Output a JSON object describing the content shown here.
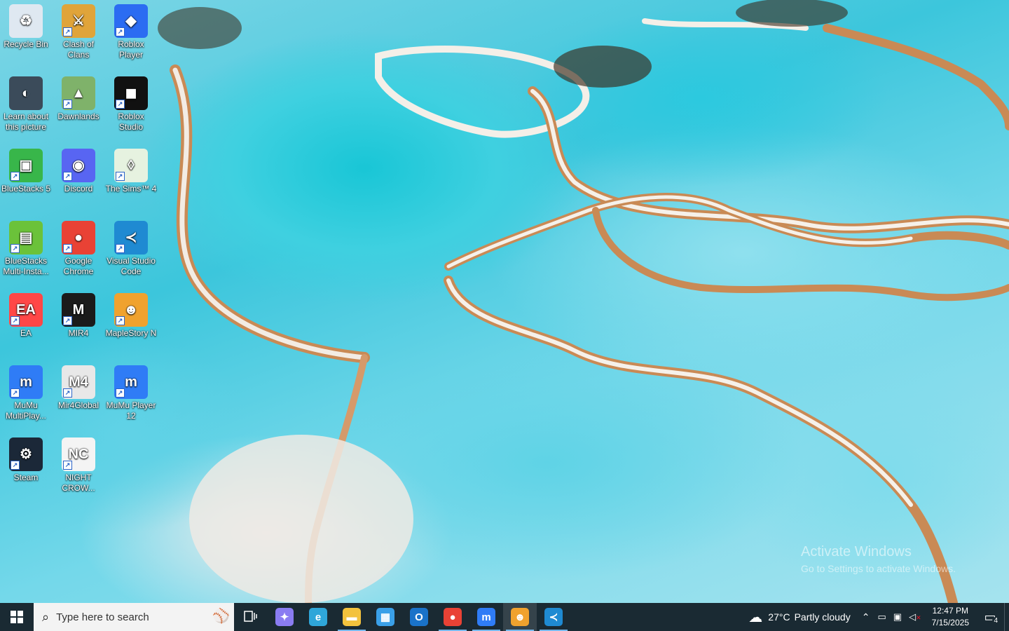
{
  "desktop_icons": [
    {
      "label": "Recycle Bin",
      "icon": "recycle-bin-icon",
      "color": "#dfe8f1",
      "glyph": "♻",
      "shortcut": false
    },
    {
      "label": "Clash of Clans",
      "icon": "clash-of-clans-icon",
      "color": "#e0a43a",
      "glyph": "⚔",
      "shortcut": true
    },
    {
      "label": "Roblox Player",
      "icon": "roblox-player-icon",
      "color": "#2b6cf2",
      "glyph": "◆",
      "shortcut": true
    },
    {
      "label": "Learn about this picture",
      "icon": "learn-about-picture-icon",
      "color": "#3b4b5a",
      "glyph": "◐",
      "shortcut": false
    },
    {
      "label": "Dawnlands",
      "icon": "dawnlands-icon",
      "color": "#7fb26a",
      "glyph": "▲",
      "shortcut": true
    },
    {
      "label": "Roblox Studio",
      "icon": "roblox-studio-icon",
      "color": "#111111",
      "glyph": "◼",
      "shortcut": true
    },
    {
      "label": "BlueStacks 5",
      "icon": "bluestacks5-icon",
      "color": "#38b64a",
      "glyph": "▣",
      "shortcut": true
    },
    {
      "label": "Discord",
      "icon": "discord-icon",
      "color": "#5865f2",
      "glyph": "◉",
      "shortcut": true
    },
    {
      "label": "The Sims™ 4",
      "icon": "sims4-icon",
      "color": "#e6f2e0",
      "glyph": "◊",
      "shortcut": true
    },
    {
      "label": "BlueStacks Multi-Insta...",
      "icon": "bluestacks-multi-icon",
      "color": "#6bc23a",
      "glyph": "▤",
      "shortcut": true
    },
    {
      "label": "Google Chrome",
      "icon": "chrome-icon",
      "color": "#e94235",
      "glyph": "●",
      "shortcut": true
    },
    {
      "label": "Visual Studio Code",
      "icon": "vscode-icon",
      "color": "#1f8ad2",
      "glyph": "≺",
      "shortcut": true
    },
    {
      "label": "EA",
      "icon": "ea-icon",
      "color": "#ff4747",
      "glyph": "EA",
      "shortcut": true
    },
    {
      "label": "MIR4",
      "icon": "mir4-icon",
      "color": "#1b1b1b",
      "glyph": "M",
      "shortcut": true
    },
    {
      "label": "MapleStory N",
      "icon": "maplestory-n-icon",
      "color": "#f0a22e",
      "glyph": "☻",
      "shortcut": true
    },
    {
      "label": "MuMu MultiPlay...",
      "icon": "mumu-multiplayer-icon",
      "color": "#2f7cf6",
      "glyph": "m",
      "shortcut": true
    },
    {
      "label": "Mir4Global",
      "icon": "mir4global-icon",
      "color": "#e8e8e8",
      "glyph": "M4",
      "shortcut": true
    },
    {
      "label": "MuMu Player 12",
      "icon": "mumu-player12-icon",
      "color": "#2f7cf6",
      "glyph": "m",
      "shortcut": true
    },
    {
      "label": "Steam",
      "icon": "steam-icon",
      "color": "#1b2838",
      "glyph": "⚙",
      "shortcut": true
    },
    {
      "label": "NIGHT CROW...",
      "icon": "night-crows-icon",
      "color": "#f4f4f4",
      "glyph": "NC",
      "shortcut": true
    }
  ],
  "taskbar": {
    "search_placeholder": "Type here to search",
    "apps": [
      {
        "name": "copilot-icon",
        "glyph": "✦",
        "color": "#8a7cf2",
        "active": false,
        "focused": false
      },
      {
        "name": "edge-icon",
        "glyph": "e",
        "color": "#2fa6d9",
        "active": false,
        "focused": false
      },
      {
        "name": "file-explorer-icon",
        "glyph": "▬",
        "color": "#f3c23d",
        "active": true,
        "focused": false
      },
      {
        "name": "microsoft-store-icon",
        "glyph": "▦",
        "color": "#3aa0e8",
        "active": false,
        "focused": false
      },
      {
        "name": "outlook-icon",
        "glyph": "O",
        "color": "#1a73c9",
        "active": false,
        "focused": false
      },
      {
        "name": "chrome-taskbar-icon",
        "glyph": "●",
        "color": "#e94235",
        "active": true,
        "focused": false
      },
      {
        "name": "mumu-taskbar-icon",
        "glyph": "m",
        "color": "#2f7cf6",
        "active": true,
        "focused": false
      },
      {
        "name": "maplestory-taskbar-icon",
        "glyph": "☻",
        "color": "#f0a22e",
        "active": true,
        "focused": true
      },
      {
        "name": "vscode-taskbar-icon",
        "glyph": "≺",
        "color": "#1f8ad2",
        "active": true,
        "focused": false
      }
    ],
    "weather": {
      "temp": "27°C",
      "condition": "Partly cloudy"
    },
    "clock": {
      "time": "12:47 PM",
      "date": "7/15/2025"
    },
    "notifications_count": "4"
  },
  "watermark": {
    "title": "Activate Windows",
    "subtitle": "Go to Settings to activate Windows."
  }
}
